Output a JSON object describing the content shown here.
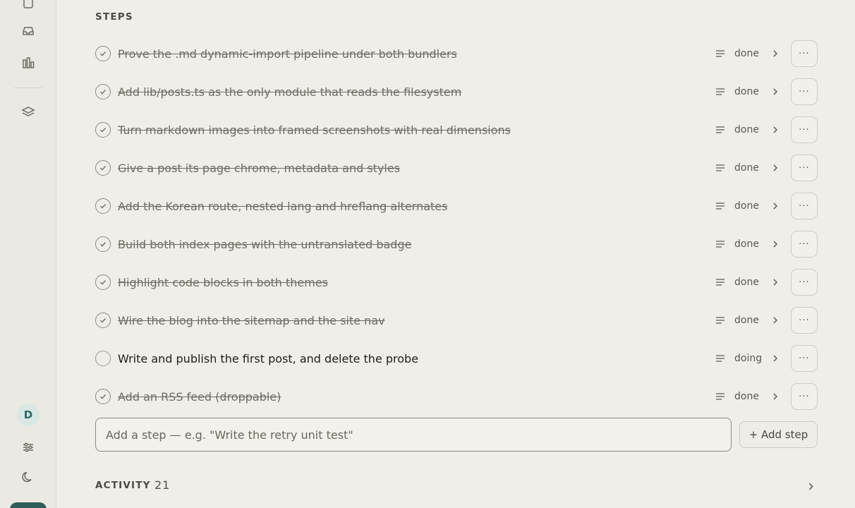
{
  "sidebar": {
    "icons": [
      "document-icon",
      "inbox-icon",
      "chart-icon",
      "layers-icon",
      "sliders-icon",
      "moon-icon"
    ],
    "avatar_initial": "D"
  },
  "steps": {
    "label": "STEPS",
    "items": [
      {
        "title": "Prove the .md dynamic-import pipeline under both bundlers",
        "status": "done"
      },
      {
        "title": "Add lib/posts.ts as the only module that reads the filesystem",
        "status": "done"
      },
      {
        "title": "Turn markdown images into framed screenshots with real dimensions",
        "status": "done"
      },
      {
        "title": "Give a post its page chrome, metadata and styles",
        "status": "done"
      },
      {
        "title": "Add the Korean route, nested lang and hreflang alternates",
        "status": "done"
      },
      {
        "title": "Build both index pages with the untranslated badge",
        "status": "done"
      },
      {
        "title": "Highlight code blocks in both themes",
        "status": "done"
      },
      {
        "title": "Wire the blog into the sitemap and the site nav",
        "status": "done"
      },
      {
        "title": "Write and publish the first post, and delete the probe",
        "status": "doing"
      },
      {
        "title": "Add an RSS feed (droppable)",
        "status": "done"
      }
    ],
    "more_label": "···",
    "add_placeholder": "Add a step — e.g. \"Write the retry unit test\"",
    "add_button": "+ Add step"
  },
  "activity": {
    "label": "ACTIVITY",
    "count": "21"
  },
  "colors": {
    "background": "#f0eee9",
    "rail": "#ebe9e3",
    "accent": "#2f5d57"
  }
}
